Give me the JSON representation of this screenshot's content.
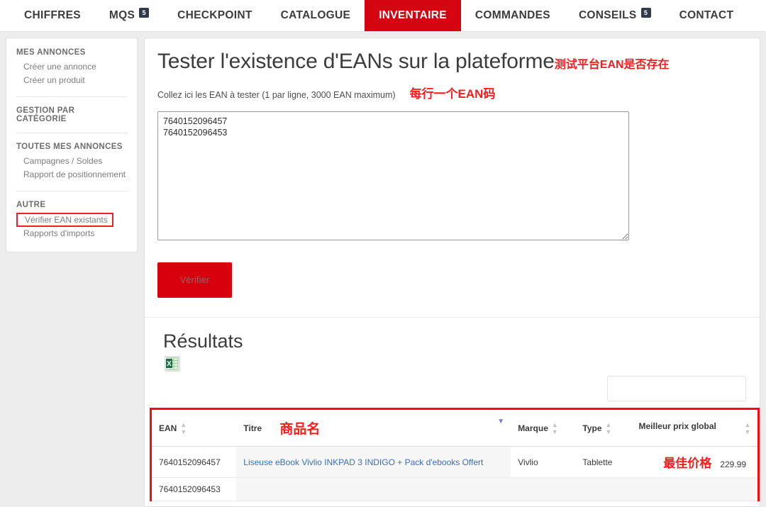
{
  "nav": {
    "items": [
      {
        "label": "CHIFFRES",
        "badge": null,
        "active": false
      },
      {
        "label": "MQS",
        "badge": "5",
        "active": false
      },
      {
        "label": "CHECKPOINT",
        "badge": null,
        "active": false
      },
      {
        "label": "CATALOGUE",
        "badge": null,
        "active": false
      },
      {
        "label": "INVENTAIRE",
        "badge": null,
        "active": true
      },
      {
        "label": "COMMANDES",
        "badge": null,
        "active": false
      },
      {
        "label": "CONSEILS",
        "badge": "5",
        "active": false
      },
      {
        "label": "CONTACT",
        "badge": null,
        "active": false
      }
    ]
  },
  "sidebar": {
    "groups": [
      {
        "title": "MES ANNONCES",
        "links": [
          {
            "label": "Créer une annonce",
            "highlight": false
          },
          {
            "label": "Créer un produit",
            "highlight": false
          }
        ]
      },
      {
        "title": "GESTION PAR CATÉGORIE",
        "links": []
      },
      {
        "title": "TOUTES MES ANNONCES",
        "links": [
          {
            "label": "Campagnes / Soldes",
            "highlight": false
          },
          {
            "label": "Rapport de positionnement",
            "highlight": false
          }
        ]
      },
      {
        "title": "AUTRE",
        "links": [
          {
            "label": "Vérifier EAN existants",
            "highlight": true
          },
          {
            "label": "Rapports d'imports",
            "highlight": false
          }
        ]
      }
    ]
  },
  "main": {
    "title": "Tester l'existence d'EANs sur la plateforme",
    "title_annotation": "测试平台EAN是否存在",
    "subtitle": "Collez ici les EAN à tester (1 par ligne, 3000 EAN maximum)",
    "subtitle_annotation": "每行一个EAN码",
    "textarea_value": "7640152096457\n7640152096453",
    "textarea_placeholder": "",
    "verify_label": "Vérifier",
    "results_title": "Résultats",
    "excel_icon": "excel-export-icon",
    "search_value": "",
    "search_placeholder": ""
  },
  "table": {
    "columns": [
      {
        "key": "ean",
        "label": "EAN",
        "sort": "both",
        "annotation": ""
      },
      {
        "key": "titre",
        "label": "Titre",
        "sort": "both",
        "annotation": "商品名"
      },
      {
        "key": "marque",
        "label": "Marque",
        "sort": "both",
        "annotation": ""
      },
      {
        "key": "type",
        "label": "Type",
        "sort": "both",
        "annotation": ""
      },
      {
        "key": "prix",
        "label": "Meilleur prix global",
        "sort": "both",
        "annotation": ""
      }
    ],
    "sorted_column": "titre",
    "sort_direction": "desc",
    "price_annotation": "最佳价格",
    "rows": [
      {
        "ean": "7640152096457",
        "titre": "Liseuse eBook Vivlio INKPAD 3 INDIGO + Pack d'ebooks Offert",
        "marque": "Vivlio",
        "type": "Tablette",
        "prix": "229.99"
      },
      {
        "ean": "7640152096453",
        "titre": "",
        "marque": "",
        "type": "",
        "prix": ""
      }
    ]
  },
  "colors": {
    "brand_red": "#d40511",
    "annotation_red": "#fa1c1c",
    "badge_dark": "#2f3b4a",
    "link_blue": "#3b6fb5"
  }
}
